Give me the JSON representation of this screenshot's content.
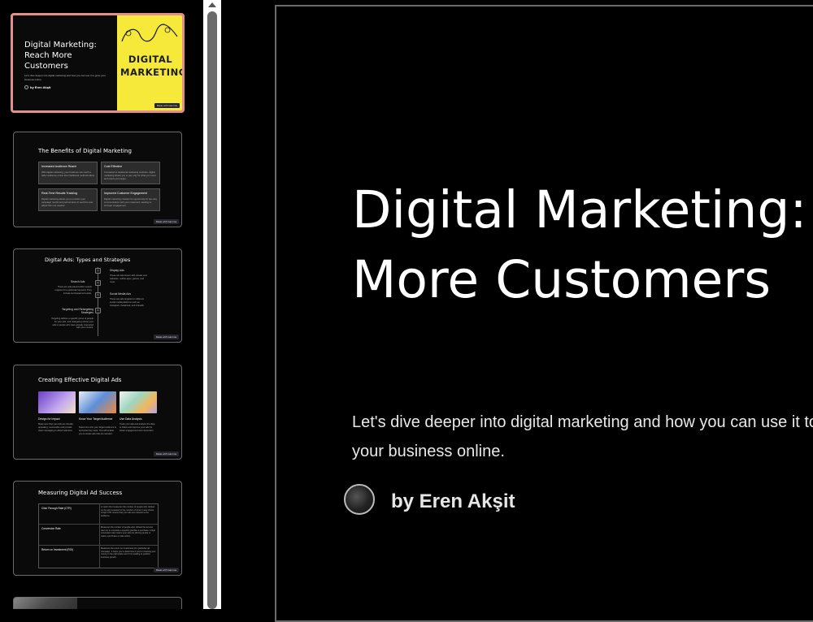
{
  "thumbnails": {
    "slide1": {
      "title": "Digital Marketing: Reach More Customers",
      "subtitle": "Let's dive deeper into digital marketing and how you can use it to grow your business online.",
      "author": "by Eren Akşit",
      "image_word1": "DIGITAL",
      "image_word2": "MARKETING",
      "badge": "Made with Gamma"
    },
    "slide2": {
      "title": "The Benefits of Digital Marketing",
      "cells": [
        {
          "heading": "Increased Audience Reach",
          "body": "With digital marketing, your business can reach a wider audience online than traditional methods allow."
        },
        {
          "heading": "Cost Effective",
          "body": "Compared to traditional marketing methods, digital marketing allows you to pay only for what you need and reach your target."
        },
        {
          "heading": "Real-Time Results Tracking",
          "body": "Digital marketing allows you to monitor your campaign results and performance in real time and adjust them as needed."
        },
        {
          "heading": "Improved Customer Engagement",
          "body": "Digital marketing creates the opportunity for two-way communication with your customers, leading to stronger engagement."
        }
      ],
      "badge": "Made with Gamma"
    },
    "slide3": {
      "title": "Digital Ads: Types and Strategies",
      "items": [
        {
          "num": "1",
          "label": "Display Ads",
          "text": "These are ads shown with visuals over websites, mobile apps, games, and more."
        },
        {
          "num": "2",
          "label": "Search Ads",
          "text": "These are ads placed within search engines for a particular keyword. They include text-based ad results."
        },
        {
          "num": "3",
          "label": "Social Media Ads",
          "text": "These are ads targeted on different social media platforms such as Instagram, Facebook, and LinkedIn."
        },
        {
          "num": "4",
          "label": "Targeting and Retargeting Strategies",
          "text": "Targeting defines a specific group of people for your ads, and retargeting shows your ads to people who have already interacted with your content."
        }
      ],
      "badge": "Made with Gamma"
    },
    "slide4": {
      "title": "Creating Effective Digital Ads",
      "cards": [
        {
          "caption": "Design for Impact",
          "body": "Make sure that your ads are visually appealing, memorable and provide clear messaging to attract attention."
        },
        {
          "caption": "Know Your Target Audience",
          "body": "Determine who your target audience is and what they want. This will enable you to create ads that are relevant."
        },
        {
          "caption": "Use Data Analysis",
          "body": "Track your ads and analyze the data to follow and improve your ads for better engagement and conversion."
        }
      ],
      "badge": "Made with Gamma"
    },
    "slide5": {
      "title": "Measuring Digital Ad Success",
      "rows": [
        {
          "metric": "Click Through Rate (CTR)",
          "desc": "A metric that measures the number of people who clicked on the ad compared to the number of times it was shown. A high CTR means that your ads are relevant to the audience."
        },
        {
          "metric": "Conversion Rate",
          "desc": "Measures the number of people who clicked the ad and went on to complete a specific goal like a purchase. A high conversion rate means your ads are driving people to make a purchase or take action."
        },
        {
          "metric": "Return on Investment (ROI)",
          "desc": "Measures the return on investment of a particular ad campaign. It helps you to determine if you're investing your money in the right place and if it is leading to positive business growth."
        }
      ],
      "badge": "Made with Gamma"
    }
  },
  "main_slide": {
    "title_line1": "Digital Marketing: Reach",
    "title_line2": "More Customers",
    "subtitle_line1": "Let's dive deeper into digital marketing and how you can use it to grow",
    "subtitle_line2": "your business online.",
    "author": "by Eren Akşit"
  },
  "colors": {
    "background": "#000000",
    "active_thumbnail_border": "#e3908a",
    "thumbnail_border": "#6b6b6b",
    "image_yellow": "#f6e93a",
    "scrollbar_thumb": "#6b6b6b"
  }
}
